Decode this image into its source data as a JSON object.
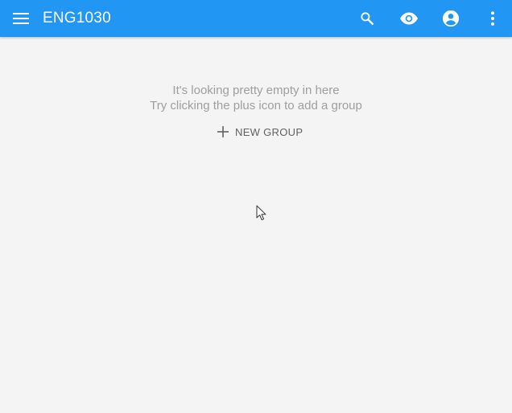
{
  "app": {
    "title": "ENG1030",
    "accent_color": "#2196f3",
    "background_color": "#f4f4f4"
  },
  "toolbar": {
    "menu_icon": "menu-icon",
    "actions": [
      {
        "name": "search",
        "icon": "search-icon"
      },
      {
        "name": "visibility",
        "icon": "eye-icon"
      },
      {
        "name": "account",
        "icon": "account-circle-icon"
      },
      {
        "name": "more",
        "icon": "more-vert-icon"
      }
    ]
  },
  "empty_state": {
    "line1": "It's looking pretty empty in here",
    "line2": "Try clicking the plus icon to add a group",
    "button_label": "NEW GROUP",
    "button_icon": "plus-icon"
  }
}
